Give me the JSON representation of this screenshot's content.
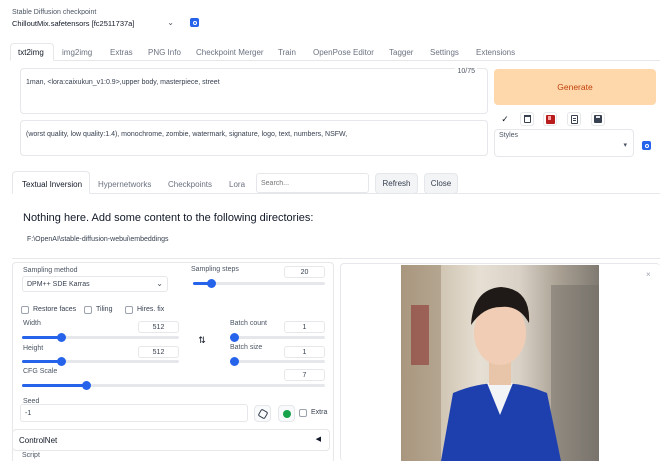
{
  "checkpoint": {
    "label": "Stable Diffusion checkpoint",
    "value": "ChilloutMix.safetensors [fc2511737a]"
  },
  "tabs": [
    "txt2img",
    "img2img",
    "Extras",
    "PNG Info",
    "Checkpoint Merger",
    "Train",
    "OpenPose Editor",
    "Tagger",
    "Settings",
    "Extensions"
  ],
  "prompt": {
    "positive": "1man, <lora:caixukun_v1:0.9>,upper body,  masterpiece, street",
    "counter": "10/75",
    "negative": "(worst quality, low quality:1.4), monochrome, zombie, watermark, signature, logo, text, numbers, NSFW,"
  },
  "generate_label": "Generate",
  "styles_label": "Styles",
  "tool_icons": [
    "check-icon",
    "trash-icon",
    "red-card-icon",
    "clipboard-icon",
    "save-icon"
  ],
  "subtabs": [
    "Textual Inversion",
    "Hypernetworks",
    "Checkpoints",
    "Lora"
  ],
  "search_placeholder": "Search...",
  "refresh_label": "Refresh",
  "close_label": "Close",
  "empty_message": "Nothing here. Add some content to the following directories:",
  "embeddings_path": "F:\\OpenAI\\stable-diffusion-webui\\embeddings",
  "sampling": {
    "method_label": "Sampling method",
    "method_value": "DPM++ SDE Karras",
    "steps_label": "Sampling steps",
    "steps_value": "20",
    "steps_fraction": 0.14
  },
  "checkboxes": [
    "Restore faces",
    "Tiling",
    "Hires. fix"
  ],
  "width": {
    "label": "Width",
    "value": "512",
    "fraction": 0.25
  },
  "height": {
    "label": "Height",
    "value": "512",
    "fraction": 0.25
  },
  "batch_count": {
    "label": "Batch count",
    "value": "1",
    "fraction": 0.0
  },
  "batch_size": {
    "label": "Batch size",
    "value": "1",
    "fraction": 0.0
  },
  "cfg": {
    "label": "CFG Scale",
    "value": "7",
    "fraction": 0.21
  },
  "seed": {
    "label": "Seed",
    "value": "-1"
  },
  "extra_label": "Extra",
  "controlnet_label": "ControlNet",
  "script_label": "Script",
  "colors": {
    "accent": "#2563eb",
    "generate_bg": "#fed7aa",
    "generate_text": "#c2410c"
  }
}
